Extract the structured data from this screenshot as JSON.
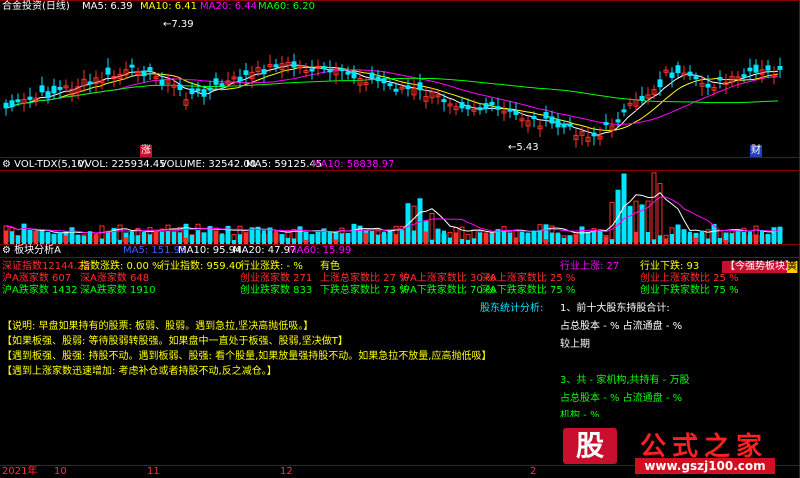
{
  "colors": {
    "up": "#ff3030",
    "down": "#00e5ff",
    "ma5": "#ffffff",
    "ma10": "#ffff00",
    "ma20": "#ff00ff",
    "ma60": "#00ff00",
    "grid": "#8b0000"
  },
  "price_panel": {
    "title": "合金投资(日线)",
    "ma5_label": "MA5: 6.39",
    "ma10_label": "MA10: 6.41",
    "ma20_label": "MA20: 6.44",
    "ma60_label": "MA60: 6.20",
    "high_marker": "7.39",
    "low_marker": "5.43",
    "zhang_mark": "涨",
    "cai_mark": "财"
  },
  "volume_panel": {
    "label": "VOL-TDX(5,10)",
    "vvol": "VVOL: 225934.45",
    "volume": "VOLUME: 32542.00",
    "ma5": "MA5: 59125.45",
    "ma10": "MA10: 58838.97"
  },
  "analysis_panel": {
    "title": "板块分析A",
    "ma5": "MA5: 151.95",
    "ma10": "MA10: 95.94",
    "ma20": "MA20: 47.97",
    "ma60": "MA60: 15.99",
    "row1": [
      "深证指数12144.22",
      "指数涨跌: 0.00 %",
      "行业指数: 959.40",
      "行业涨跌: - %",
      "有色"
    ],
    "row1_right": [
      "行业上涨: 27",
      "行业下跌: 93"
    ],
    "badge": "【今强势板块】",
    "badge_tail": "黄",
    "row2": [
      "沪A涨家数 607",
      "深A涨家数 648",
      "创业涨家数 271",
      "上涨总家数比 27 %",
      "沪A上涨家数比 30 %",
      "深A上涨家数比 25 %",
      "创业上涨家数比 25 %"
    ],
    "row3": [
      "沪A跌家数 1432",
      "深A跌家数 1910",
      "创业跌家数 833",
      "下跌总家数比 73 %",
      "沪A下跌家数比 70 %",
      "深A下跌家数比 75 %",
      "创业下跌家数比 75 %"
    ],
    "shareholder_title": "股东统计分析:",
    "top10_title": "1、前十大股东持股合计:",
    "top10_line": "占总股本 - %    占流通盘 - %",
    "prev_period": "较上期",
    "inst_title": "3、共 - 家机构,共持有 - 万股",
    "inst_line": "占总股本 - %    占流通盘 - %",
    "partial": "机构 - %",
    "notes": [
      "【说明: 早盘如果持有的股票: 板弱、股弱。遇到急拉,坚决高抛低吸。】",
      "【如果板强、股弱: 等待股弱转股强。如果盘中一直处于板强、股弱,坚决做T】",
      "【遇到板强、股强: 持股不动。遇到板弱、股强: 看个股量,如果放量强持股不动。如果急拉不放量,应高抛低吸】",
      "【遇到上涨家数迅速增加: 考虑补仓或者持股不动,反之减仓。】"
    ]
  },
  "x_axis": [
    "2021年",
    "10",
    "11",
    "12",
    "2"
  ],
  "watermark": {
    "gu": "股",
    "name": "公式之家",
    "url": "www.gszj100.com"
  },
  "chart_data": {
    "type": "candlestick",
    "title": "合金投资(日线)",
    "ma_values": {
      "MA5": 6.39,
      "MA10": 6.41,
      "MA20": 6.44,
      "MA60": 6.2
    },
    "annotated_high": 7.39,
    "annotated_low": 5.43,
    "volume_summary": {
      "VVOL": 225934.45,
      "VOLUME": 32542.0,
      "MA5": 59125.45,
      "MA10": 58838.97
    }
  }
}
